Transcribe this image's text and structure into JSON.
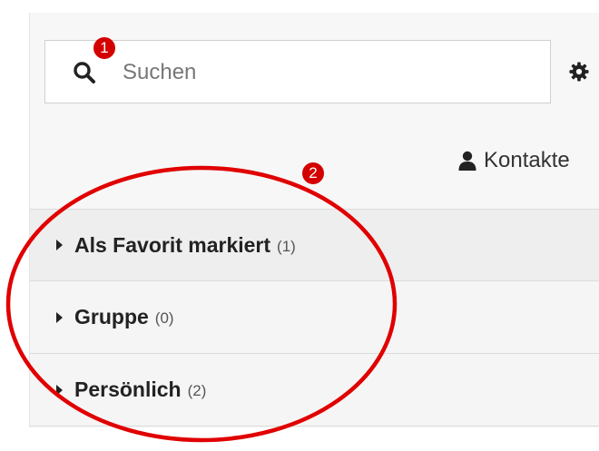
{
  "search": {
    "placeholder": "Suchen",
    "icon": "search-icon"
  },
  "settings": {
    "icon": "gear-icon"
  },
  "contacts": {
    "label": "Kontakte",
    "icon": "person-icon"
  },
  "groups": [
    {
      "name": "Als Favorit markiert",
      "count": "(1)",
      "expanded": false
    },
    {
      "name": "Gruppe",
      "count": "(0)",
      "expanded": false
    },
    {
      "name": "Persönlich",
      "count": "(2)",
      "expanded": false
    }
  ],
  "annotations": {
    "badge_1": "1",
    "badge_2": "2",
    "color": "#e00000"
  }
}
